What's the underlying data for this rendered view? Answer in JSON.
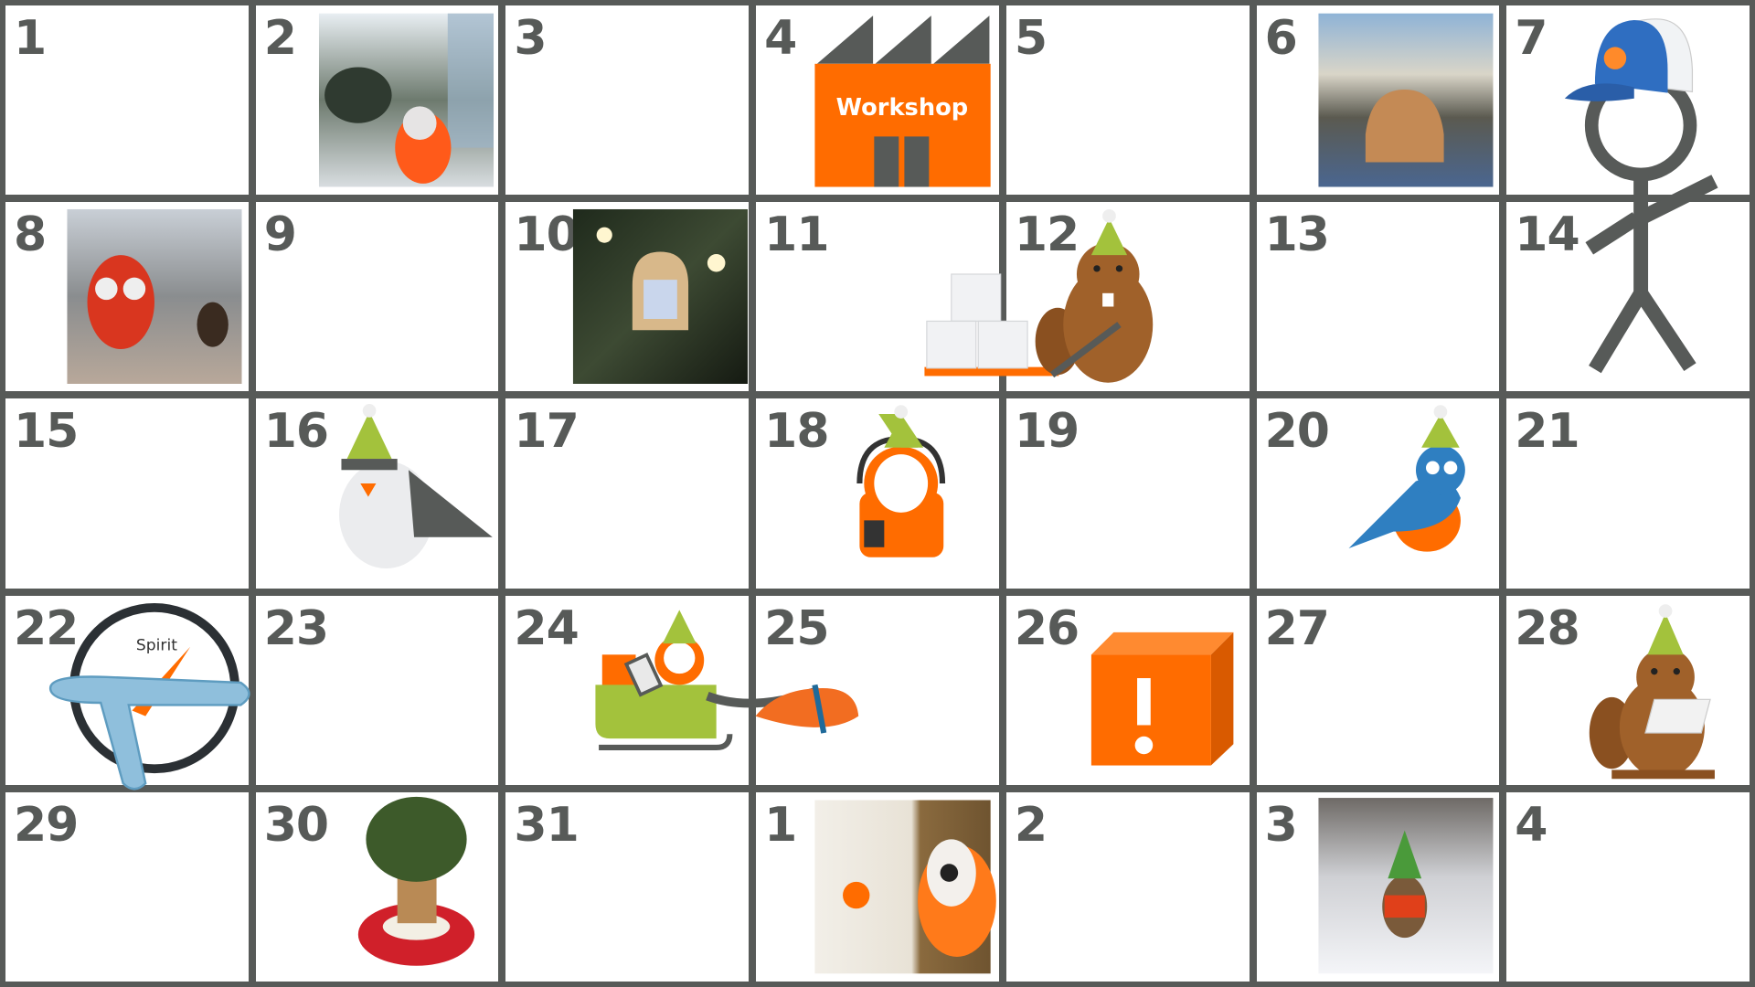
{
  "calendar": {
    "days": [
      "1",
      "2",
      "3",
      "4",
      "5",
      "6",
      "7",
      "8",
      "9",
      "10",
      "11",
      "12",
      "13",
      "14",
      "15",
      "16",
      "17",
      "18",
      "19",
      "20",
      "21",
      "22",
      "23",
      "24",
      "25",
      "26",
      "27",
      "28",
      "29",
      "30",
      "31",
      "1",
      "2",
      "3",
      "4"
    ]
  },
  "illustrations": {
    "workshop_label": "Workshop",
    "compass_label": "Spirit"
  },
  "colors": {
    "grid": "#575a58",
    "orange": "#ff6c00",
    "green": "#a3c23c",
    "blue": "#2f7fc1",
    "beaver": "#a0612a"
  }
}
